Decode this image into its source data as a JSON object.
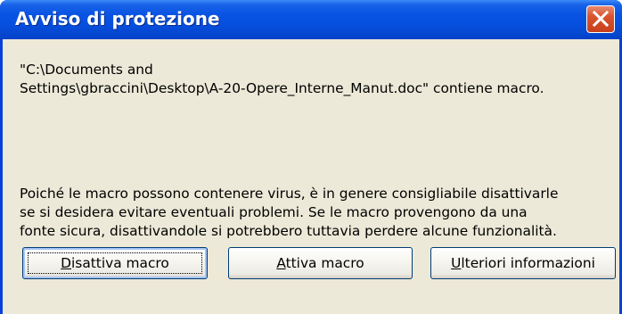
{
  "dialog": {
    "title": "Avviso di protezione",
    "message_line1": "\"C:\\Documents and",
    "message_line2": "Settings\\gbraccini\\Desktop\\A-20-Opere_Interne_Manut.doc\" contiene macro.",
    "warning_line1": "Poiché le macro possono contenere virus, è in genere consigliabile disattivarle",
    "warning_line2": "se si desidera evitare eventuali problemi. Se le macro provengono da una",
    "warning_line3": "fonte sicura, disattivandole si potrebbero tuttavia perdere alcune funzionalità.",
    "close_icon": "close-x-icon"
  },
  "buttons": {
    "disable": {
      "accel": "D",
      "rest": "isattiva macro"
    },
    "enable": {
      "accel": "A",
      "rest": "ttiva macro"
    },
    "more": {
      "accel": "U",
      "rest": "lteriori informazioni"
    }
  },
  "colors": {
    "titlebar": "#0a54e3",
    "close_button": "#d9522e",
    "body": "#ece9d8"
  }
}
